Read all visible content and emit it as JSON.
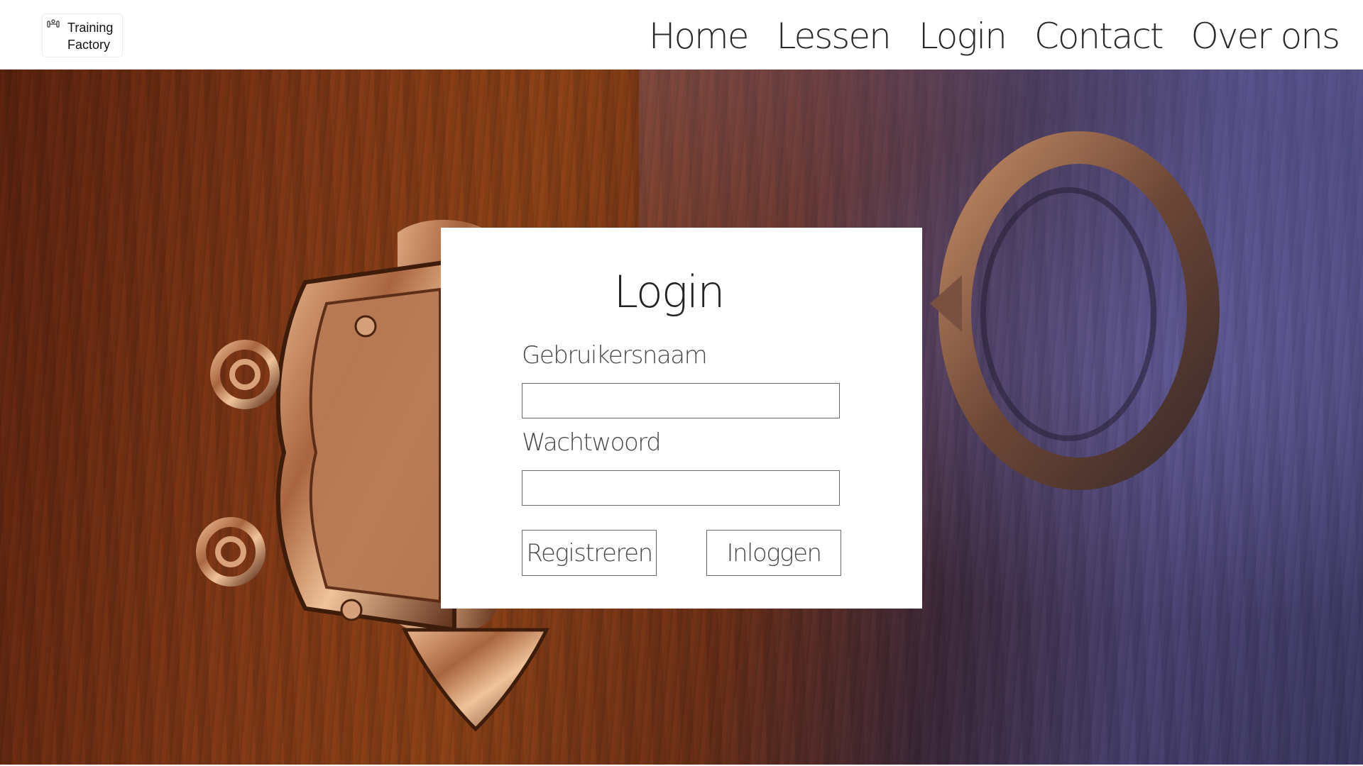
{
  "header": {
    "logo": {
      "line1": "Training",
      "line2": "Factory",
      "icon": "dumbbell-icon"
    },
    "nav": [
      {
        "label": "Home"
      },
      {
        "label": "Lessen"
      },
      {
        "label": "Login"
      },
      {
        "label": "Contact"
      },
      {
        "label": "Over ons"
      }
    ]
  },
  "hero": {
    "background": "keyhole-and-key-image"
  },
  "login": {
    "title": "Login",
    "username_label": "Gebruikersnaam",
    "username_value": "",
    "password_label": "Wachtwoord",
    "password_value": "",
    "register_label": "Registreren",
    "login_label": "Inloggen"
  },
  "colors": {
    "wood": "#823a17",
    "beam": "#4a4476",
    "brass": "#b07a55",
    "text": "#2a2a2a"
  }
}
